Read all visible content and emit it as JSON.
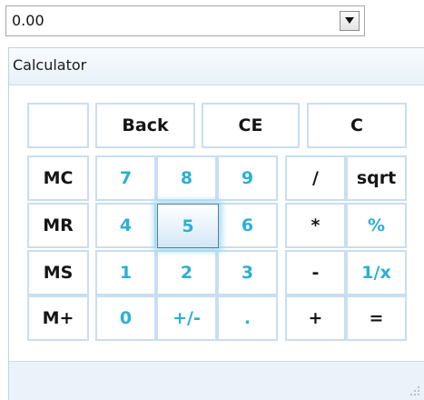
{
  "combo": {
    "value": "0.00",
    "dropdown_icon": "triangle-down-icon"
  },
  "panel": {
    "title": "Calculator",
    "grip_icon": "resize-grip-icon"
  },
  "keys": {
    "blank": "",
    "back": "Back",
    "ce": "CE",
    "c": "C",
    "mc": "MC",
    "mr": "MR",
    "ms": "MS",
    "mplus": "M+",
    "d7": "7",
    "d8": "8",
    "d9": "9",
    "d4": "4",
    "d5": "5",
    "d6": "6",
    "d1": "1",
    "d2": "2",
    "d3": "3",
    "d0": "0",
    "sign": "+/-",
    "dot": ".",
    "div": "/",
    "sqrt": "sqrt",
    "mul": "*",
    "pct": "%",
    "sub": "-",
    "recip": "1/x",
    "add": "+",
    "eq": "="
  },
  "colors": {
    "digit": "#2bb0d4",
    "operator": "#151515",
    "border": "#c9def0"
  }
}
